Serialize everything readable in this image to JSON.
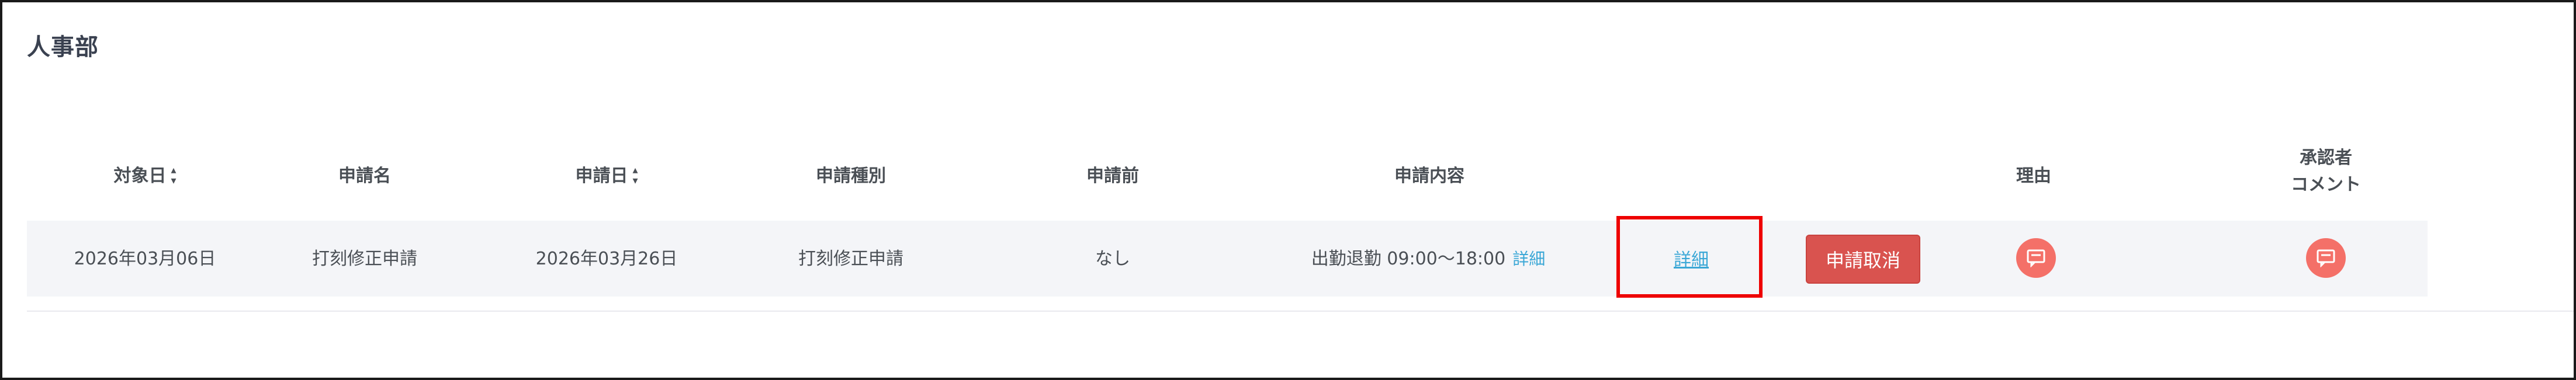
{
  "department": {
    "title": "人事部"
  },
  "table": {
    "headers": {
      "target_date": "対象日",
      "request_name": "申請名",
      "request_date": "申請日",
      "request_type": "申請種別",
      "before": "申請前",
      "content": "申請内容",
      "reason": "理由",
      "approver_comment_line1": "承認者",
      "approver_comment_line2": "コメント",
      "sort_icon": "sort-icon"
    },
    "rows": [
      {
        "target_date": "2026年03月06日",
        "request_name": "打刻修正申請",
        "request_date": "2026年03月26日",
        "request_type": "打刻修正申請",
        "before": "なし",
        "content": "出勤退勤 09:00～18:00",
        "content_detail_link": "詳細",
        "detail_link": "詳細",
        "cancel_button": "申請取消",
        "reason_icon": "comment-icon",
        "approver_comment_icon": "comment-icon"
      }
    ]
  },
  "colors": {
    "cancel_button_bg": "#d9534f",
    "comment_icon_bg": "#f47068",
    "link": "#3aa7d6",
    "highlight": "#ee0000",
    "row_bg": "#f4f5f8"
  }
}
